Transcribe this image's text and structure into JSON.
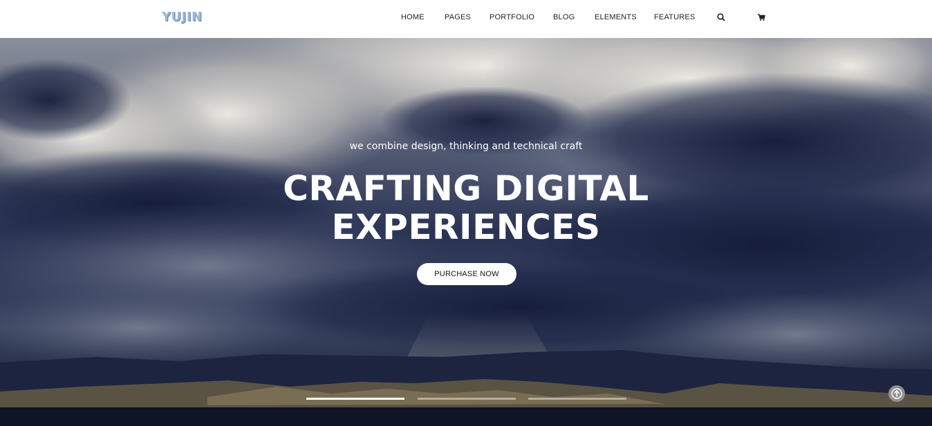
{
  "brand": {
    "logo_text": "YUJIN"
  },
  "nav": {
    "items": [
      {
        "label": "HOME"
      },
      {
        "label": "PAGES"
      },
      {
        "label": "PORTFOLIO"
      },
      {
        "label": "BLOG"
      },
      {
        "label": "ELEMENTS"
      },
      {
        "label": "FEATURES"
      }
    ],
    "icons": [
      "search-icon",
      "cart-icon"
    ]
  },
  "hero": {
    "subtitle": "we combine design, thinking and technical craft",
    "title_line_1": "CRAFTING DIGITAL",
    "title_line_2": "EXPERIENCES",
    "cta_label": "PURCHASE NOW",
    "slides": {
      "count": 3,
      "active_index": 0
    }
  },
  "colors": {
    "header_bg": "#ffffff",
    "nav_text": "#222222",
    "logo": "#9cb7d6",
    "hero_text": "#ffffff",
    "sky_dark": "#1b2340",
    "cta_bg": "#ffffff"
  },
  "scroll_to_top_icon": "arrow-up-icon"
}
